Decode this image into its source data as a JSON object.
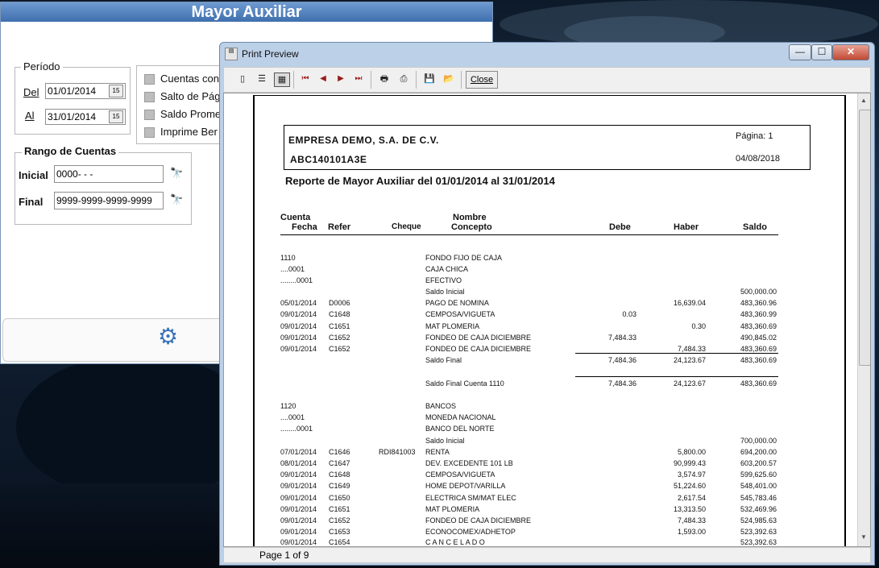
{
  "mayor": {
    "title": "Mayor Auxiliar",
    "periodo_label": "Período",
    "del_label": "Del",
    "del_value": "01/01/2014",
    "al_label": "Al",
    "al_value": "31/01/2014",
    "cal_icon": "15",
    "options": [
      "Cuentas con",
      "Salto de Pág",
      "Saldo Prome",
      "Imprime Ber"
    ],
    "rango_label": "Rango de Cuentas",
    "inicial_label": "Inicial",
    "inicial_value": "0000-   -   -",
    "final_label": "Final",
    "final_value": "9999-9999-9999-9999"
  },
  "preview": {
    "title": "Print Preview",
    "close_label": "Close",
    "status": "Page 1 of 9",
    "window_controls": {
      "minimize": "—",
      "maximize": "☐",
      "close": "✕"
    }
  },
  "report": {
    "company": "EMPRESA DEMO, S.A. DE C.V.",
    "rfc": "ABC140101A3E",
    "page_label": "Página: 1",
    "date": "04/08/2018",
    "title": "Reporte de Mayor Auxiliar del 01/01/2014 al 31/01/2014",
    "columns": {
      "cuenta": "Cuenta",
      "fecha": "Fecha",
      "refer": "Refer",
      "cheque": "Cheque",
      "nombre": "Nombre",
      "concepto": "Concepto",
      "debe": "Debe",
      "haber": "Haber",
      "saldo": "Saldo"
    },
    "rows": [
      {
        "c0": "1110",
        "c1": "",
        "c2": "",
        "c3": "FONDO FIJO DE CAJA",
        "d": "",
        "h": "",
        "s": ""
      },
      {
        "c0": "....0001",
        "c1": "",
        "c2": "",
        "c3": "CAJA CHICA",
        "d": "",
        "h": "",
        "s": ""
      },
      {
        "c0": "........0001",
        "c1": "",
        "c2": "",
        "c3": "EFECTIVO",
        "d": "",
        "h": "",
        "s": ""
      },
      {
        "c0": "",
        "c1": "",
        "c2": "",
        "c3": "Saldo Inicial",
        "d": "",
        "h": "",
        "s": "500,000.00"
      },
      {
        "c0": "05/01/2014",
        "c1": "D0006",
        "c2": "",
        "c3": "PAGO DE NOMINA",
        "d": "",
        "h": "16,639.04",
        "s": "483,360.96"
      },
      {
        "c0": "09/01/2014",
        "c1": "C1648",
        "c2": "",
        "c3": "CEMPOSA/VIGUETA",
        "d": "0.03",
        "h": "",
        "s": "483,360.99"
      },
      {
        "c0": "09/01/2014",
        "c1": "C1651",
        "c2": "",
        "c3": "MAT PLOMERIA",
        "d": "",
        "h": "0.30",
        "s": "483,360.69"
      },
      {
        "c0": "09/01/2014",
        "c1": "C1652",
        "c2": "",
        "c3": "FONDEO DE CAJA DICIEMBRE",
        "d": "7,484.33",
        "h": "",
        "s": "490,845.02"
      },
      {
        "c0": "09/01/2014",
        "c1": "C1652",
        "c2": "",
        "c3": "FONDEO DE CAJA DICIEMBRE",
        "d": "",
        "h": "7,484.33",
        "s": "483,360.69"
      },
      {
        "c0": "",
        "c1": "",
        "c2": "",
        "c3": "Saldo Final",
        "d": "7,484.36",
        "h": "24,123.67",
        "s": "483,360.69"
      },
      {
        "c0": "",
        "c1": "",
        "c2": "",
        "c3": "Saldo Final Cuenta 1110",
        "d": "7,484.36",
        "h": "24,123.67",
        "s": "483,360.69"
      },
      {
        "c0": "1120",
        "c1": "",
        "c2": "",
        "c3": "BANCOS",
        "d": "",
        "h": "",
        "s": ""
      },
      {
        "c0": "....0001",
        "c1": "",
        "c2": "",
        "c3": "MONEDA NACIONAL",
        "d": "",
        "h": "",
        "s": ""
      },
      {
        "c0": "........0001",
        "c1": "",
        "c2": "",
        "c3": "BANCO DEL NORTE",
        "d": "",
        "h": "",
        "s": ""
      },
      {
        "c0": "",
        "c1": "",
        "c2": "",
        "c3": "Saldo Inicial",
        "d": "",
        "h": "",
        "s": "700,000.00"
      },
      {
        "c0": "07/01/2014",
        "c1": "C1646",
        "c2": "RDI841003",
        "c3": "RENTA",
        "d": "",
        "h": "5,800.00",
        "s": "694,200.00"
      },
      {
        "c0": "08/01/2014",
        "c1": "C1647",
        "c2": "",
        "c3": "DEV. EXCEDENTE 101 LB",
        "d": "",
        "h": "90,999.43",
        "s": "603,200.57"
      },
      {
        "c0": "09/01/2014",
        "c1": "C1648",
        "c2": "",
        "c3": "CEMPOSA/VIGUETA",
        "d": "",
        "h": "3,574.97",
        "s": "599,625.60"
      },
      {
        "c0": "09/01/2014",
        "c1": "C1649",
        "c2": "",
        "c3": "HOME DEPOT/VARILLA",
        "d": "",
        "h": "51,224.60",
        "s": "548,401.00"
      },
      {
        "c0": "09/01/2014",
        "c1": "C1650",
        "c2": "",
        "c3": "ELECTRICA SM/MAT ELEC",
        "d": "",
        "h": "2,617.54",
        "s": "545,783.46"
      },
      {
        "c0": "09/01/2014",
        "c1": "C1651",
        "c2": "",
        "c3": "MAT PLOMERIA",
        "d": "",
        "h": "13,313.50",
        "s": "532,469.96"
      },
      {
        "c0": "09/01/2014",
        "c1": "C1652",
        "c2": "",
        "c3": "FONDEO DE CAJA DICIEMBRE",
        "d": "",
        "h": "7,484.33",
        "s": "524,985.63"
      },
      {
        "c0": "09/01/2014",
        "c1": "C1653",
        "c2": "",
        "c3": "ECONOCOMEX/ADHETOP",
        "d": "",
        "h": "1,593.00",
        "s": "523,392.63"
      },
      {
        "c0": "09/01/2014",
        "c1": "C1654",
        "c2": "",
        "c3": "C A N C E L A D O",
        "d": "",
        "h": "",
        "s": "523,392.63"
      }
    ]
  }
}
